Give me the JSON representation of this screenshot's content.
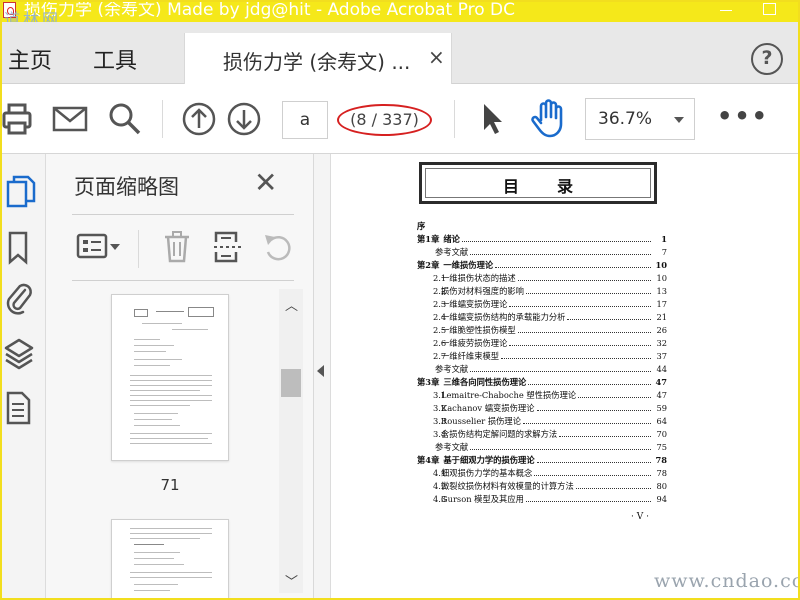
{
  "window": {
    "title": "损伤力学 (余寿文) Made by jdg@hit - Adobe Acrobat Pro DC",
    "watermark_top": "道林网"
  },
  "nav": {
    "home": "主页",
    "tools": "工具",
    "tab_label": "损伤力学 (余寿文) ...",
    "tab_close": "×",
    "help": "?"
  },
  "toolbar": {
    "page_input": "a",
    "page_count": "(8 / 337)",
    "zoom": "36.7%",
    "more": "•••"
  },
  "panel": {
    "title": "页面缩略图",
    "close": "✕",
    "thumbnails": [
      {
        "label": "71"
      }
    ]
  },
  "toc": {
    "title": "目录",
    "items": [
      {
        "type": "preface",
        "label": "序",
        "page": ""
      },
      {
        "type": "chapter",
        "label": "第1章",
        "text": "绪论",
        "page": "1"
      },
      {
        "type": "ref",
        "text": "参考文献",
        "page": "7"
      },
      {
        "type": "chapter",
        "label": "第2章",
        "text": "一维损伤理论",
        "page": "10"
      },
      {
        "type": "sub",
        "num": "2.1",
        "text": "一维损伤状态的描述",
        "page": "10"
      },
      {
        "type": "sub",
        "num": "2.2",
        "text": "损伤对材料强度的影响",
        "page": "13"
      },
      {
        "type": "sub",
        "num": "2.3",
        "text": "一维蠕变损伤理论",
        "page": "17"
      },
      {
        "type": "sub",
        "num": "2.4",
        "text": "一维蠕变损伤结构的承载能力分析",
        "page": "21"
      },
      {
        "type": "sub",
        "num": "2.5",
        "text": "一维脆塑性损伤模型",
        "page": "26"
      },
      {
        "type": "sub",
        "num": "2.6",
        "text": "一维疲劳损伤理论",
        "page": "32"
      },
      {
        "type": "sub",
        "num": "2.7",
        "text": "一维纤维束模型",
        "page": "37"
      },
      {
        "type": "ref",
        "text": "参考文献",
        "page": "44"
      },
      {
        "type": "chapter",
        "label": "第3章",
        "text": "三维各向同性损伤理论",
        "page": "47"
      },
      {
        "type": "sub",
        "num": "3.1",
        "text": "Lemaitre-Chaboche 塑性损伤理论",
        "page": "47"
      },
      {
        "type": "sub",
        "num": "3.2",
        "text": "Kachanov 蠕变损伤理论",
        "page": "59"
      },
      {
        "type": "sub",
        "num": "3.3",
        "text": "Rousselier 损伤理论",
        "page": "64"
      },
      {
        "type": "sub",
        "num": "3.4",
        "text": "含损伤结构定解问题的求解方法",
        "page": "70"
      },
      {
        "type": "ref",
        "text": "参考文献",
        "page": "75"
      },
      {
        "type": "chapter",
        "label": "第4章",
        "text": "基于细观力学的损伤理论",
        "page": "78"
      },
      {
        "type": "sub",
        "num": "4.1",
        "text": "细观损伤力学的基本概念",
        "page": "78"
      },
      {
        "type": "sub",
        "num": "4.2",
        "text": "微裂纹损伤材料有效模量的计算方法",
        "page": "80"
      },
      {
        "type": "sub",
        "num": "4.3",
        "text": "Gurson 模型及其应用",
        "page": "94"
      }
    ],
    "page_roman": "· V ·"
  },
  "watermark_bottom": "www.cndao.com",
  "colors": {
    "titlebar": "#f5e81a",
    "annotation_circle": "#d62020",
    "select_blue": "#1a6bcc"
  }
}
